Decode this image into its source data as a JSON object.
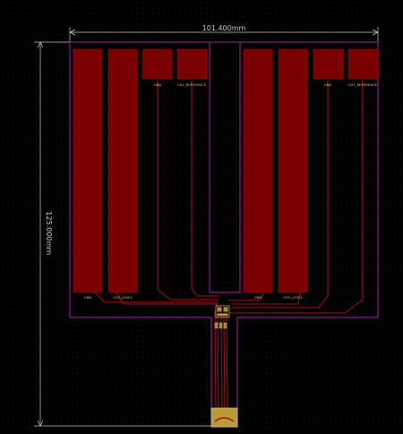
{
  "dimensions": {
    "width_label": "101.400mm",
    "height_label": "125.000mm"
  },
  "labels": {
    "gnd_left": "GND",
    "gnd_small_left": "GND",
    "ch2_level": "CH2_LEVEL",
    "ch2_reference": "CH2_REFERENCE",
    "gnd_right": "GND",
    "gnd_small_right": "GND",
    "ch1_level": "CH1_LEVEL",
    "ch1_reference": "CH1_REFERENCE"
  },
  "colors": {
    "background": "#000000",
    "copper_fill": "#7a0000",
    "copper_stroke": "#a30000",
    "trace": "#b01010",
    "outline": "#8a1a8a",
    "dimension": "#c8c8c8",
    "label": "#e0c060",
    "connector": "#b89a3a"
  }
}
